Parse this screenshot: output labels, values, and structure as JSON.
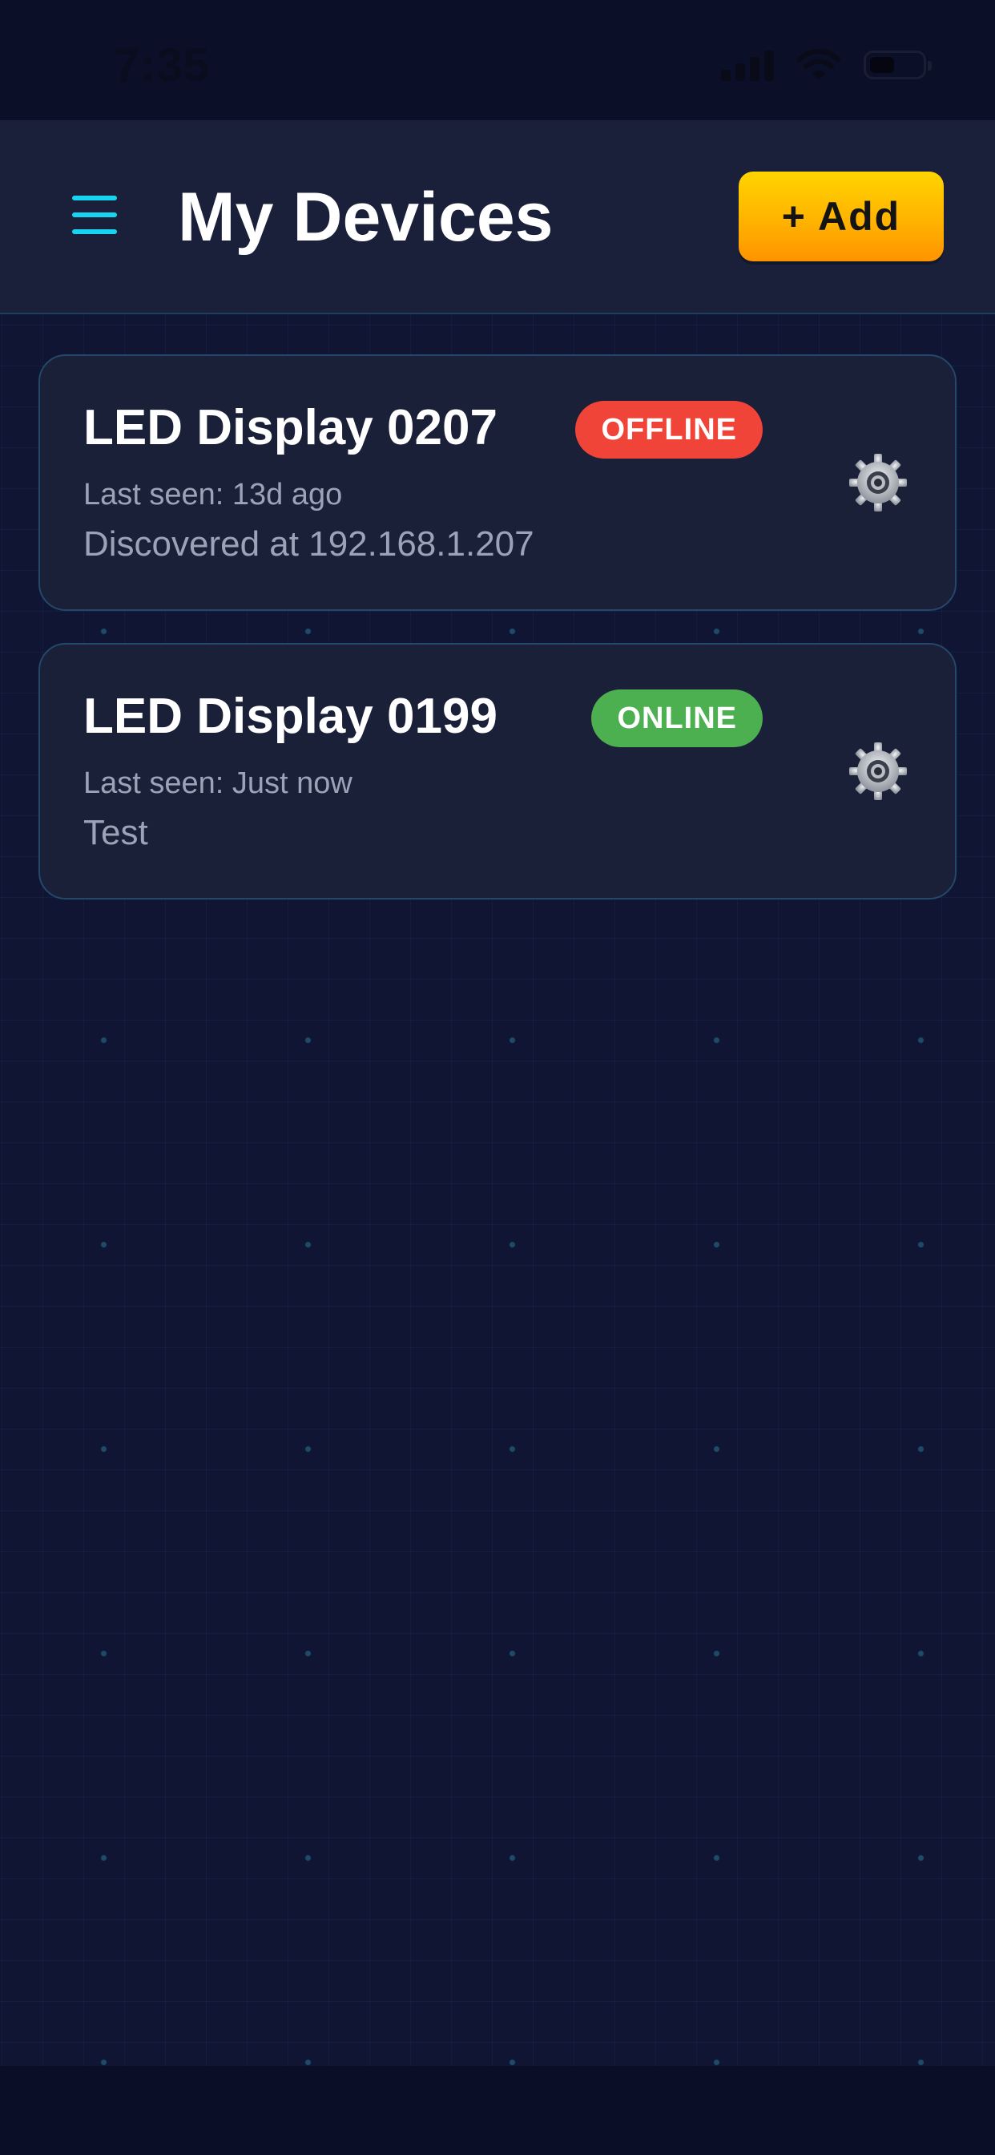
{
  "status_bar": {
    "time": "7:35"
  },
  "header": {
    "title": "My Devices",
    "add_label": "+ Add",
    "menu_icon": "hamburger-menu-icon",
    "accent_color": "#19d4f0",
    "add_button_color": "#ffc000"
  },
  "devices": [
    {
      "name": "LED Display 0207",
      "status": "OFFLINE",
      "status_color": "#f04438",
      "last_seen": "Last seen: 13d ago",
      "description": "Discovered at 192.168.1.207",
      "settings_icon": "gear-icon"
    },
    {
      "name": "LED Display 0199",
      "status": "ONLINE",
      "status_color": "#4caf50",
      "last_seen": "Last seen: Just now",
      "description": "Test",
      "settings_icon": "gear-icon"
    }
  ]
}
